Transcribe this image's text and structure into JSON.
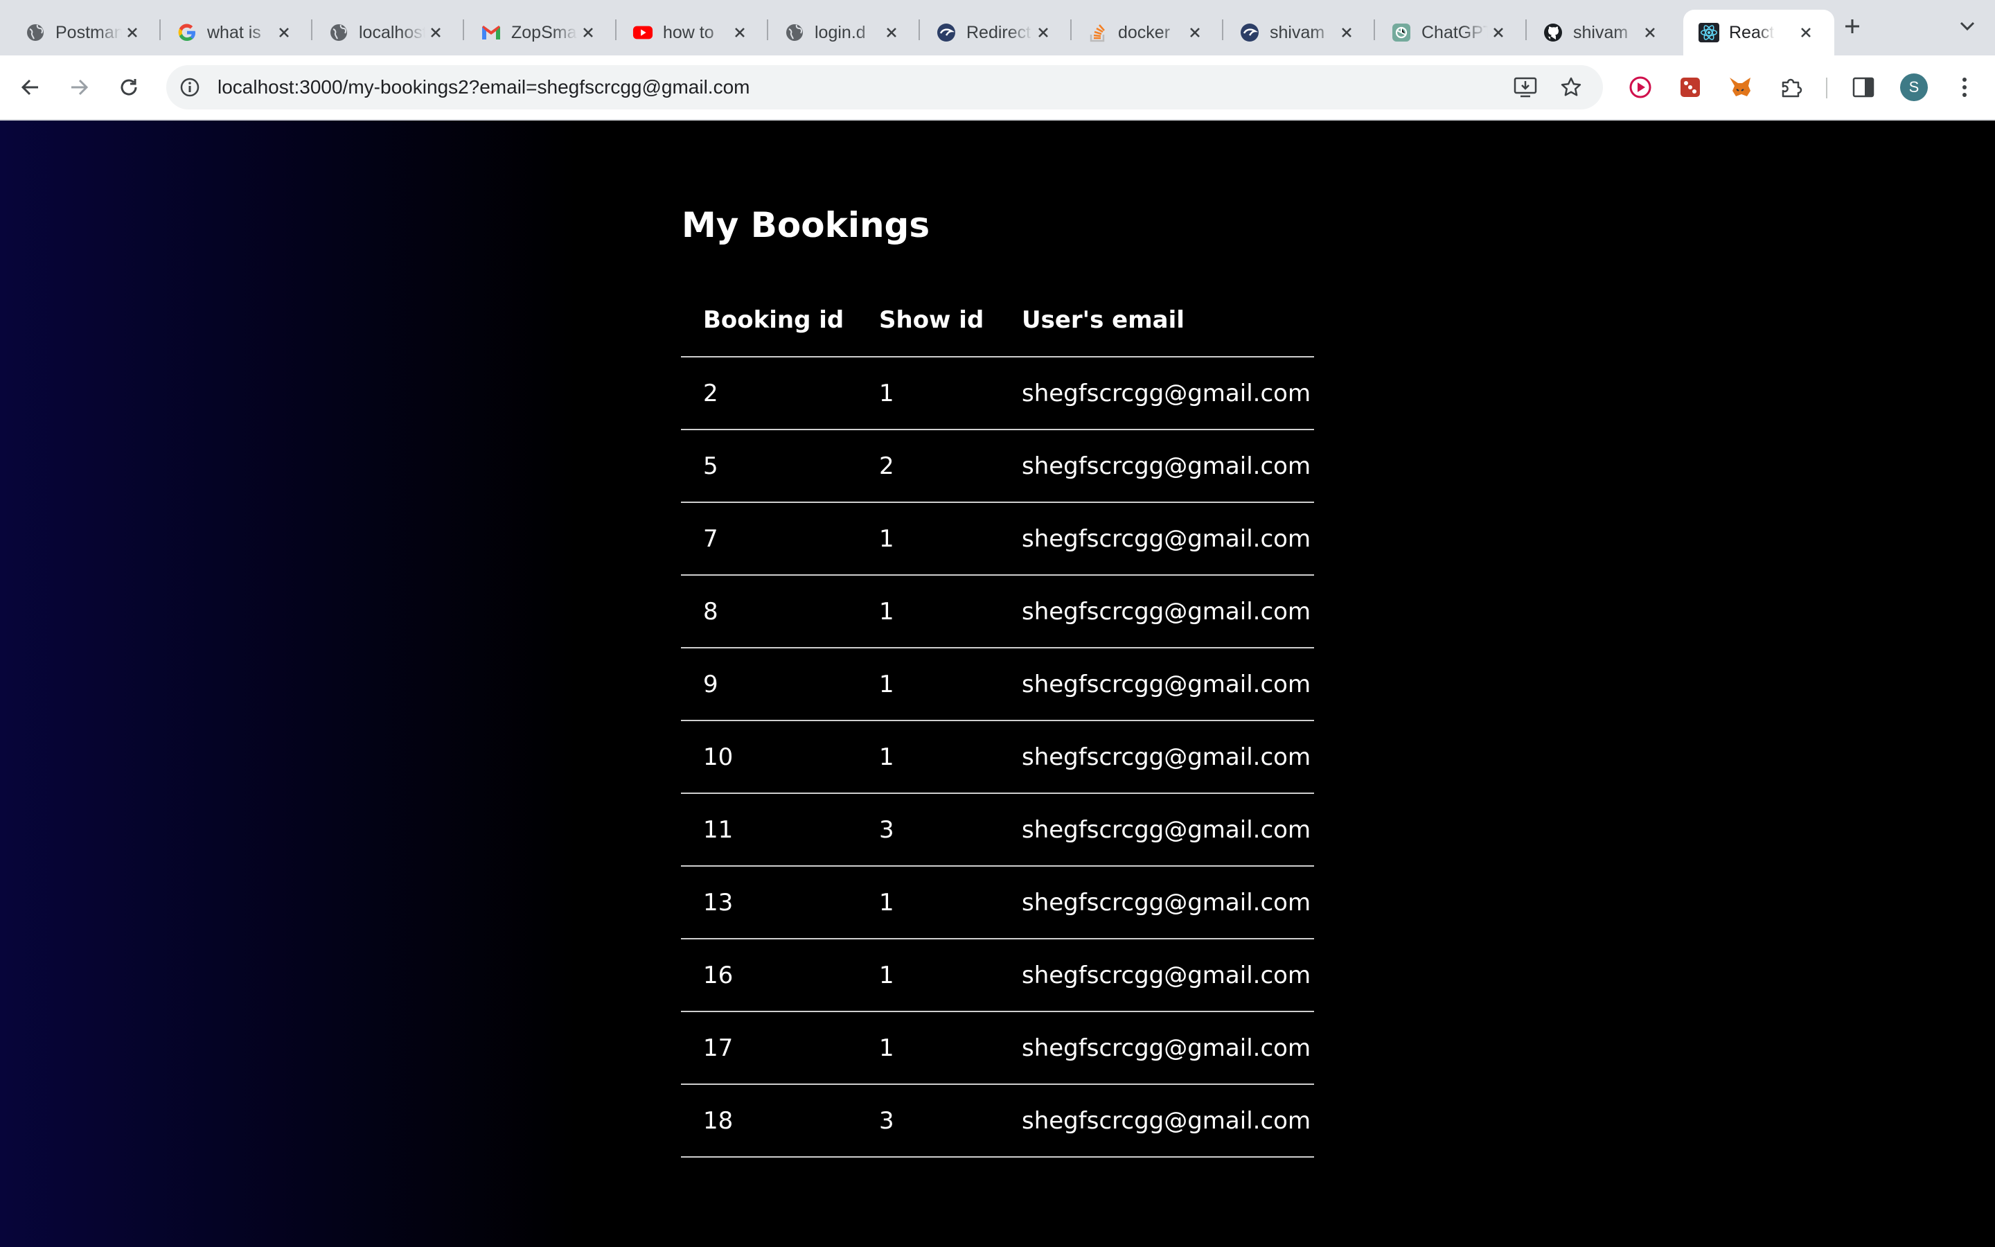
{
  "browser": {
    "tabs": [
      {
        "title": "Postman",
        "icon": "globe-icon",
        "active": false
      },
      {
        "title": "what is",
        "icon": "google-icon",
        "active": false
      },
      {
        "title": "localhost",
        "icon": "globe-icon",
        "active": false
      },
      {
        "title": "ZopSmart",
        "icon": "gmail-icon",
        "active": false
      },
      {
        "title": "how to",
        "icon": "youtube-icon",
        "active": false
      },
      {
        "title": "login.d",
        "icon": "globe-icon",
        "active": false
      },
      {
        "title": "Redirect",
        "icon": "docker-icon",
        "active": false
      },
      {
        "title": "docker",
        "icon": "stackoverflow-icon",
        "active": false
      },
      {
        "title": "shivam",
        "icon": "docker-icon",
        "active": false
      },
      {
        "title": "ChatGPT",
        "icon": "chatgpt-icon",
        "active": false
      },
      {
        "title": "shivam",
        "icon": "github-icon",
        "active": false
      },
      {
        "title": "React App",
        "icon": "react-icon",
        "active": true
      }
    ],
    "url": "localhost:3000/my-bookings2?email=shegfscrcgg@gmail.com",
    "profile_initial": "S"
  },
  "page": {
    "title": "My Bookings",
    "columns": [
      "Booking id",
      "Show id",
      "User's email"
    ],
    "rows": [
      [
        "2",
        "1",
        "shegfscrcgg@gmail.com"
      ],
      [
        "5",
        "2",
        "shegfscrcgg@gmail.com"
      ],
      [
        "7",
        "1",
        "shegfscrcgg@gmail.com"
      ],
      [
        "8",
        "1",
        "shegfscrcgg@gmail.com"
      ],
      [
        "9",
        "1",
        "shegfscrcgg@gmail.com"
      ],
      [
        "10",
        "1",
        "shegfscrcgg@gmail.com"
      ],
      [
        "11",
        "3",
        "shegfscrcgg@gmail.com"
      ],
      [
        "13",
        "1",
        "shegfscrcgg@gmail.com"
      ],
      [
        "16",
        "1",
        "shegfscrcgg@gmail.com"
      ],
      [
        "17",
        "1",
        "shegfscrcgg@gmail.com"
      ],
      [
        "18",
        "3",
        "shegfscrcgg@gmail.com"
      ]
    ]
  },
  "colors": {
    "background": "#000000",
    "background_gradient_left": "#07053a",
    "text": "#ffffff",
    "row_border": "#cfcfcf"
  }
}
